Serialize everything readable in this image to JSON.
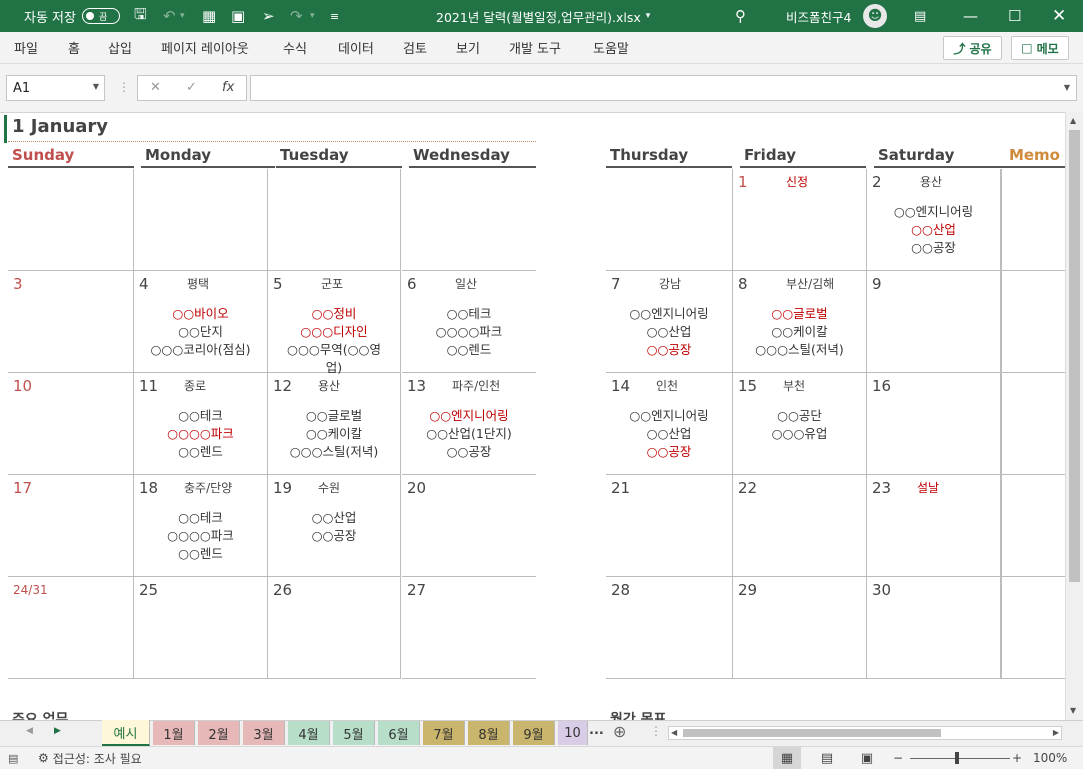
{
  "titlebar": {
    "autosave_label": "자동 저장",
    "autosave_state": "끔",
    "filename": "2021년 달력(월별일정,업무관리).xlsx",
    "filename_caret": "▾",
    "username": "비즈폼친구4",
    "icons": [
      "save-icon",
      "undo-icon",
      "form-icon",
      "camera-icon",
      "pointer-icon",
      "redo-icon",
      "customize-icon",
      "search-icon",
      "ribbon-display-icon",
      "minimize-icon",
      "maximize-icon",
      "close-icon"
    ]
  },
  "menu": {
    "items": [
      "파일",
      "홈",
      "삽입",
      "페이지 레이아웃",
      "수식",
      "데이터",
      "검토",
      "보기",
      "개발 도구",
      "도움말"
    ],
    "share_label": "공유",
    "comment_label": "메모"
  },
  "formula": {
    "namebox": "A1",
    "cancel": "✕",
    "enter": "✓",
    "fx": "fx",
    "value": ""
  },
  "calendar": {
    "month_title": "1 January",
    "days_left": [
      "Sunday",
      "Monday",
      "Tuesday",
      "Wednesday"
    ],
    "days_right": [
      "Thursday",
      "Friday",
      "Saturday"
    ],
    "memo_label": "Memo",
    "weeks": [
      {
        "left": [
          {
            "day": "",
            "loc": "",
            "lines": []
          },
          {
            "day": "",
            "loc": "",
            "lines": []
          },
          {
            "day": "",
            "loc": "",
            "lines": []
          },
          {
            "day": "",
            "loc": "",
            "lines": []
          }
        ],
        "right": [
          {
            "day": "",
            "loc": "",
            "lines": []
          },
          {
            "day": "1",
            "loc": "신정",
            "loc_red": true,
            "day_red": true,
            "lines": []
          },
          {
            "day": "2",
            "loc": "용산",
            "lines": [
              {
                "t": "○○엔지니어링"
              },
              {
                "t": "○○산업",
                "red": true
              },
              {
                "t": "○○공장"
              }
            ]
          }
        ]
      },
      {
        "left": [
          {
            "day": "3",
            "day_red": true,
            "loc": "",
            "lines": []
          },
          {
            "day": "4",
            "loc": "평택",
            "lines": [
              {
                "t": "○○바이오",
                "red": true
              },
              {
                "t": "○○단지"
              },
              {
                "t": "○○○코리아(점심)"
              }
            ]
          },
          {
            "day": "5",
            "loc": "군포",
            "lines": [
              {
                "t": "○○정비",
                "red": true
              },
              {
                "t": "○○○디자인",
                "red": true
              },
              {
                "t": "○○○무역(○○영"
              },
              {
                "t": "업)"
              }
            ]
          },
          {
            "day": "6",
            "loc": "일산",
            "lines": [
              {
                "t": "○○테크"
              },
              {
                "t": "○○○○파크"
              },
              {
                "t": "○○렌드"
              }
            ]
          }
        ],
        "right": [
          {
            "day": "7",
            "loc": "강남",
            "lines": [
              {
                "t": "○○엔지니어링"
              },
              {
                "t": "○○산업"
              },
              {
                "t": "○○공장",
                "red": true
              }
            ]
          },
          {
            "day": "8",
            "loc": "부산/김해",
            "lines": [
              {
                "t": "○○글로벌",
                "red": true
              },
              {
                "t": "○○케이칼"
              },
              {
                "t": "○○○스틸(저녁)"
              }
            ]
          },
          {
            "day": "9",
            "loc": "",
            "lines": []
          }
        ]
      },
      {
        "left": [
          {
            "day": "10",
            "day_red": true,
            "loc": "",
            "lines": []
          },
          {
            "day": "11",
            "loc": "종로",
            "lines": [
              {
                "t": "○○테크"
              },
              {
                "t": "○○○○파크",
                "red": true
              },
              {
                "t": "○○렌드"
              }
            ]
          },
          {
            "day": "12",
            "loc": "용산",
            "lines": [
              {
                "t": "○○글로벌"
              },
              {
                "t": "○○케이칼"
              },
              {
                "t": "○○○스틸(저녁)"
              }
            ]
          },
          {
            "day": "13",
            "loc": "파주/인천",
            "lines": [
              {
                "t": "○○엔지니어링",
                "red": true
              },
              {
                "t": "○○산업(1단지)"
              },
              {
                "t": "○○공장"
              }
            ]
          }
        ],
        "right": [
          {
            "day": "14",
            "loc": "인천",
            "lines": [
              {
                "t": "○○엔지니어링"
              },
              {
                "t": "○○산업"
              },
              {
                "t": "○○공장",
                "red": true
              }
            ]
          },
          {
            "day": "15",
            "loc": "부천",
            "lines": [
              {
                "t": "○○공단"
              },
              {
                "t": "○○○유업"
              }
            ]
          },
          {
            "day": "16",
            "loc": "",
            "lines": []
          }
        ]
      },
      {
        "left": [
          {
            "day": "17",
            "day_red": true,
            "loc": "",
            "lines": []
          },
          {
            "day": "18",
            "loc": "충주/단양",
            "lines": [
              {
                "t": "○○테크"
              },
              {
                "t": "○○○○파크"
              },
              {
                "t": "○○렌드"
              }
            ]
          },
          {
            "day": "19",
            "loc": "수원",
            "lines": [
              {
                "t": "○○산업"
              },
              {
                "t": "○○공장"
              }
            ]
          },
          {
            "day": "20",
            "loc": "",
            "lines": []
          }
        ],
        "right": [
          {
            "day": "21",
            "loc": "",
            "lines": []
          },
          {
            "day": "22",
            "loc": "",
            "lines": []
          },
          {
            "day": "23",
            "loc": "설날",
            "loc_red": true,
            "lines": []
          }
        ]
      },
      {
        "left": [
          {
            "day": "24/31",
            "day_red": true,
            "small": true,
            "loc": "",
            "lines": []
          },
          {
            "day": "25",
            "loc": "",
            "lines": []
          },
          {
            "day": "26",
            "loc": "",
            "lines": []
          },
          {
            "day": "27",
            "loc": "",
            "lines": []
          }
        ],
        "right": [
          {
            "day": "28",
            "loc": "",
            "lines": []
          },
          {
            "day": "29",
            "loc": "",
            "lines": []
          },
          {
            "day": "30",
            "loc": "",
            "lines": []
          }
        ]
      }
    ],
    "footer_left": "주요 업무",
    "footer_right": "월간 목표"
  },
  "tabs": [
    {
      "label": "예시",
      "color": "#fff2cc",
      "active": true
    },
    {
      "label": "1월",
      "color": "#e6b8b7"
    },
    {
      "label": "2월",
      "color": "#e6b8b7"
    },
    {
      "label": "3월",
      "color": "#e6b8b7"
    },
    {
      "label": "4월",
      "color": "#b7dec8"
    },
    {
      "label": "5월",
      "color": "#b7dec8"
    },
    {
      "label": "6월",
      "color": "#b7dec8"
    },
    {
      "label": "7월",
      "color": "#c9b56b"
    },
    {
      "label": "8월",
      "color": "#c9b56b"
    },
    {
      "label": "9월",
      "color": "#c9b56b"
    },
    {
      "label": "10",
      "color": "#d9cce6"
    }
  ],
  "tab_more": "...",
  "status": {
    "accessibility": "접근성: 조사 필요",
    "zoom": "100%",
    "zoom_minus": "−",
    "zoom_plus": "+"
  }
}
